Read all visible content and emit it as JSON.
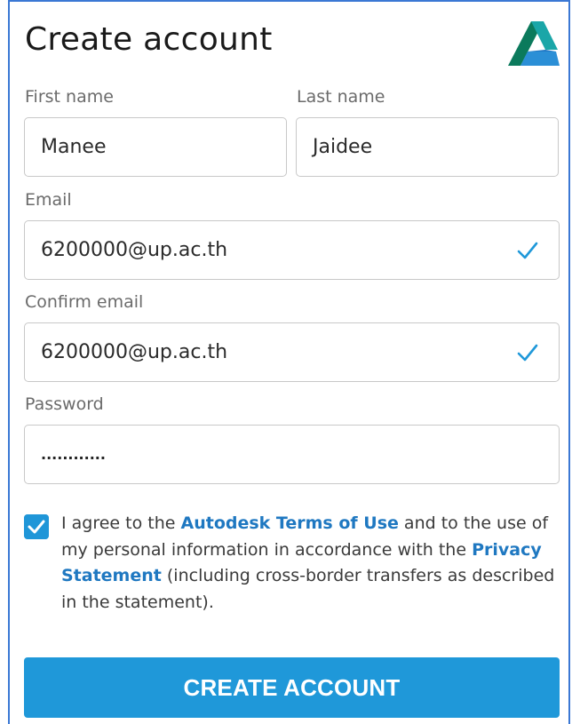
{
  "form": {
    "title": "Create account",
    "first_name": {
      "label": "First name",
      "value": "Manee"
    },
    "last_name": {
      "label": "Last name",
      "value": "Jaidee"
    },
    "email": {
      "label": "Email",
      "value": "6200000@up.ac.th",
      "valid": true
    },
    "confirm_email": {
      "label": "Confirm email",
      "value": "6200000@up.ac.th",
      "valid": true
    },
    "password": {
      "label": "Password",
      "masked_value": "............"
    },
    "agree": {
      "checked": true,
      "text_1": "I agree to the ",
      "link_terms": "Autodesk Terms of Use",
      "text_2": " and to the use of my personal information in accordance with the ",
      "link_privacy": "Privacy Statement",
      "text_3": " (including cross-border transfers as described in the statement)."
    },
    "submit_label": "CREATE ACCOUNT"
  },
  "icons": {
    "logo": "autodesk-logo-icon",
    "valid": "checkmark-icon",
    "checkbox": "checkbox-checked-icon"
  },
  "colors": {
    "accent": "#1f98d9",
    "link": "#1f78c1",
    "label": "#6b6b6b",
    "frame": "#3b78d4"
  }
}
